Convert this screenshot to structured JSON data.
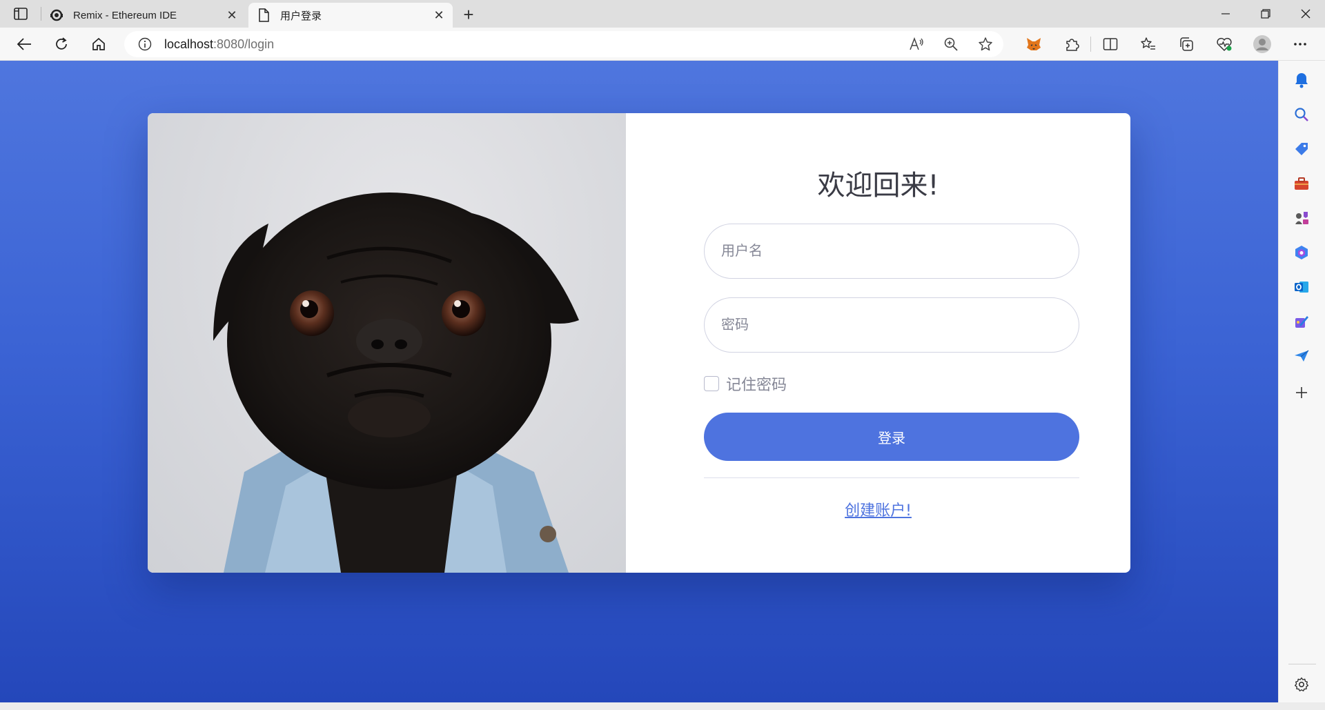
{
  "browser": {
    "tabs": [
      {
        "title": "Remix - Ethereum IDE",
        "active": false,
        "close": "✕"
      },
      {
        "title": "用户登录",
        "active": true,
        "close": "✕"
      }
    ],
    "new_tab": "+",
    "address": {
      "host": "localhost",
      "path": ":8080/login"
    },
    "icons": {
      "tab_actions": "tab-actions-icon",
      "back": "back-arrow-icon",
      "refresh": "refresh-icon",
      "home": "home-icon",
      "info": "info-icon",
      "read_aloud": "read-aloud-icon",
      "zoom": "zoom-icon",
      "favorite": "star-icon",
      "metamask": "metamask-fox-icon",
      "extensions": "puzzle-icon",
      "split": "split-screen-icon",
      "favorites": "favorites-icon",
      "collections": "collections-icon",
      "health": "browser-essentials-icon",
      "profile": "profile-avatar-icon",
      "more": "more-icon"
    }
  },
  "login": {
    "title": "欢迎回来!",
    "username_placeholder": "用户名",
    "password_placeholder": "密码",
    "remember_label": "记住密码",
    "submit_label": "登录",
    "create_account_link": "创建账户!"
  },
  "colors": {
    "primary": "#4e73df",
    "background_top": "#4f76de",
    "background_bottom": "#2447ba"
  },
  "sidebar": {
    "icons": [
      "bell-icon",
      "search-icon",
      "tag-icon",
      "toolbox-icon",
      "games-icon",
      "copilot-icon",
      "outlook-icon",
      "designer-icon",
      "send-icon",
      "add-icon",
      "settings-icon"
    ]
  }
}
